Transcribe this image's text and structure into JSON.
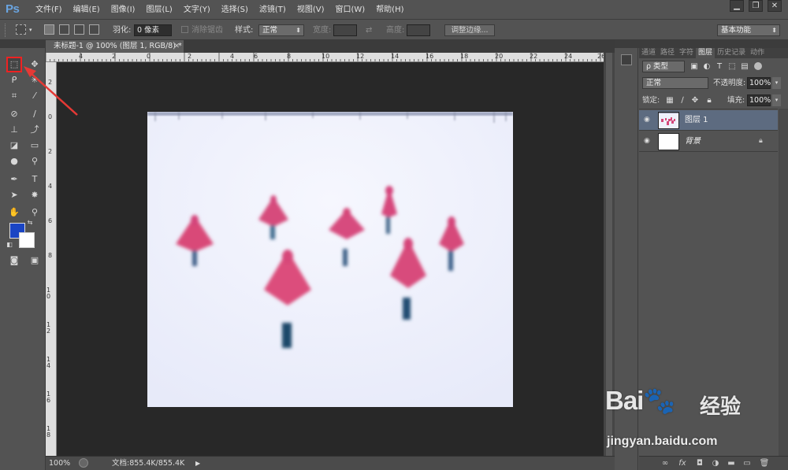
{
  "app": {
    "logo": "Ps"
  },
  "menu": [
    "文件(F)",
    "编辑(E)",
    "图像(I)",
    "图层(L)",
    "文字(Y)",
    "选择(S)",
    "滤镜(T)",
    "视图(V)",
    "窗口(W)",
    "帮助(H)"
  ],
  "window_controls": [
    "▁",
    "❐",
    "✕"
  ],
  "options": {
    "feather_label": "羽化:",
    "feather_value": "0 像素",
    "antialias_label": "消除锯齿",
    "style_label": "样式:",
    "style_value": "正常",
    "width_label": "宽度:",
    "height_label": "高度:",
    "refine_button": "调整边缘...",
    "workspace": "基本功能"
  },
  "document": {
    "tab_title": "未标题-1 @ 100% (图层 1, RGB/8) *",
    "zoom": "100%",
    "doc_size": "文档:855.4K/855.4K"
  },
  "ruler": {
    "h_labels": [
      "4",
      "2",
      "0",
      "2",
      "4",
      "6",
      "8",
      "10",
      "12",
      "14",
      "16",
      "18",
      "20",
      "22",
      "24",
      "26"
    ],
    "v_labels": [
      "2",
      "0",
      "2",
      "4",
      "6",
      "8",
      "10",
      "12",
      "14",
      "16",
      "18"
    ]
  },
  "tools": {
    "items": [
      {
        "name": "rect-marquee-tool",
        "glyph": "⬚"
      },
      {
        "name": "move-tool",
        "glyph": "✥"
      },
      {
        "name": "lasso-tool",
        "glyph": "ᑭ"
      },
      {
        "name": "magic-wand-tool",
        "glyph": "✳"
      },
      {
        "name": "crop-tool",
        "glyph": "⌗"
      },
      {
        "name": "eyedropper-tool",
        "glyph": "⁄"
      },
      {
        "name": "healing-brush-tool",
        "glyph": "⊘"
      },
      {
        "name": "brush-tool",
        "glyph": "∕"
      },
      {
        "name": "clone-stamp-tool",
        "glyph": "⊥"
      },
      {
        "name": "history-brush-tool",
        "glyph": "⤴"
      },
      {
        "name": "eraser-tool",
        "glyph": "◪"
      },
      {
        "name": "gradient-tool",
        "glyph": "▭"
      },
      {
        "name": "blur-tool",
        "glyph": "●"
      },
      {
        "name": "dodge-tool",
        "glyph": "⚲"
      },
      {
        "name": "pen-tool",
        "glyph": "✒"
      },
      {
        "name": "type-tool",
        "glyph": "T"
      },
      {
        "name": "path-selection-tool",
        "glyph": "➤"
      },
      {
        "name": "custom-shape-tool",
        "glyph": "✸"
      },
      {
        "name": "hand-tool",
        "glyph": "✋"
      },
      {
        "name": "zoom-tool",
        "glyph": "⚲"
      },
      {
        "name": "quick-mask-tool",
        "glyph": "◙"
      },
      {
        "name": "screen-mode-tool",
        "glyph": "▣"
      }
    ],
    "fg_color": "#1a45c4",
    "bg_color": "#ffffff"
  },
  "panel": {
    "tabs": [
      "通道",
      "路径",
      "字符",
      "图层",
      "历史记录",
      "动作"
    ],
    "active_tab": "图层",
    "filter_kind": "ρ 类型",
    "blend_mode": "正常",
    "opacity_label": "不透明度:",
    "opacity_value": "100%",
    "lock_label": "锁定:",
    "fill_label": "填充:",
    "fill_value": "100%",
    "layers": [
      {
        "name": "图层 1",
        "selected": true
      },
      {
        "name": "背景",
        "selected": false,
        "locked": true
      }
    ]
  },
  "footer_icons": [
    "link-icon",
    "fx-icon",
    "mask-icon",
    "adjustment-icon",
    "group-folder-icon",
    "new-layer-icon",
    "trash-icon"
  ],
  "watermark": {
    "brand": "Bai🐾",
    "jy": "经验",
    "url": "jingyan.baidu.com"
  }
}
